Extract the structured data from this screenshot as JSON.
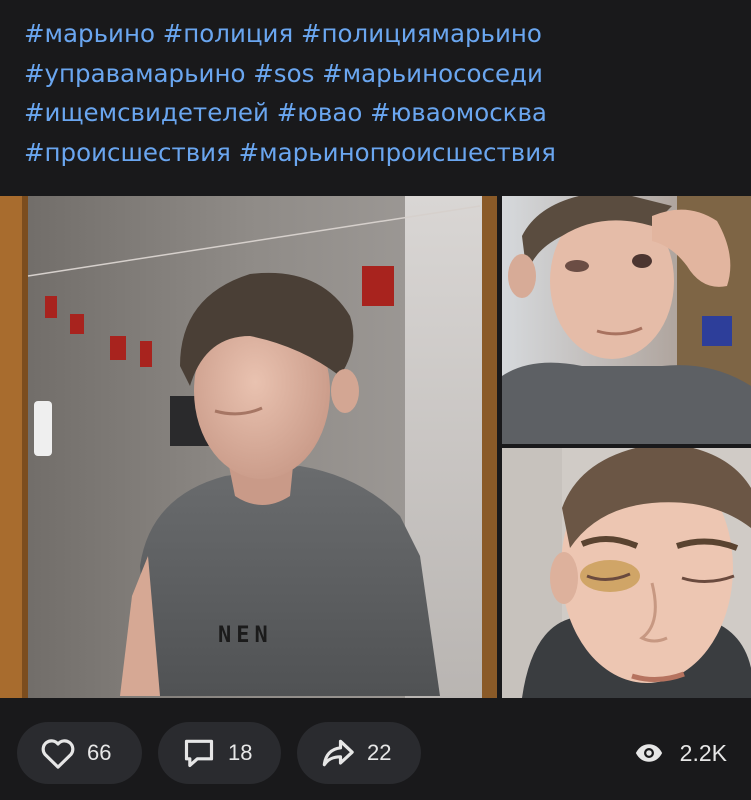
{
  "post": {
    "hashtag_lines": [
      [
        "#марьино",
        "#полиция",
        "#полициямарьино"
      ],
      [
        "#управамарьино",
        "#sos",
        "#марьинососеди"
      ],
      [
        "#ищемсвидетелей",
        "#ювао",
        "#ювaoмосква"
      ],
      [
        "#происшествия",
        "#марьинопроисшествия"
      ]
    ],
    "photos": [
      {
        "shirt_print": "NEN"
      },
      {},
      {}
    ]
  },
  "actions": {
    "like": {
      "icon": "heart-icon",
      "count": "66"
    },
    "comment": {
      "icon": "comment-icon",
      "count": "18"
    },
    "share": {
      "icon": "share-arrow-icon",
      "count": "22"
    },
    "views": {
      "icon": "eye-icon",
      "count": "2.2K"
    }
  },
  "colors": {
    "background": "#19191b",
    "hashtag": "#6aa6f0",
    "pill": "#2a2b2f",
    "text": "#e7e7e7"
  }
}
